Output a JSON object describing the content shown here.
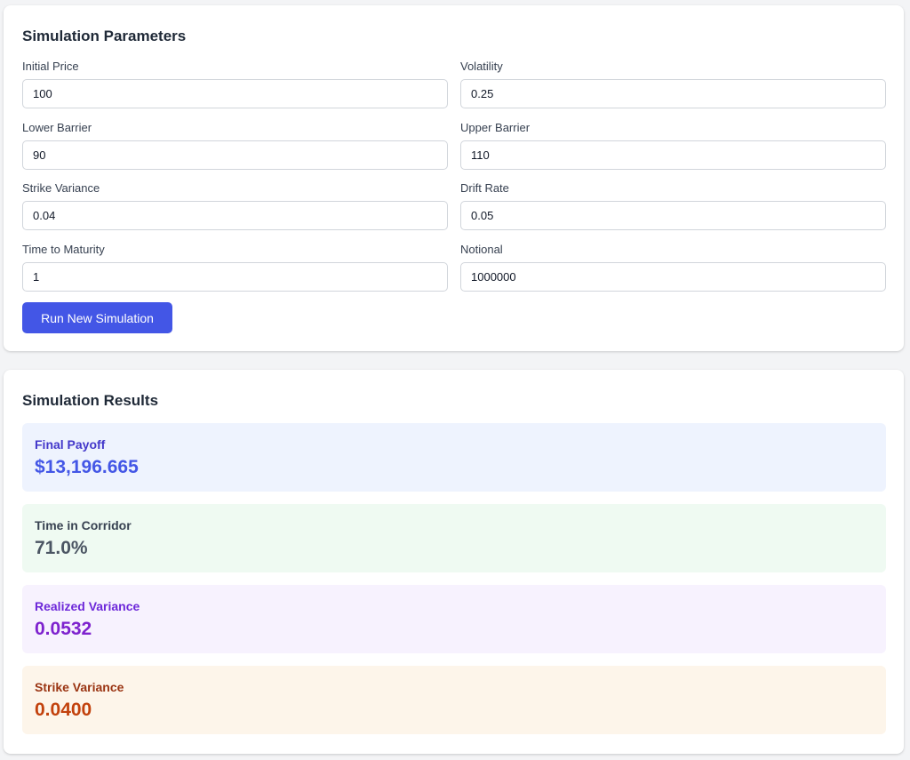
{
  "parameters": {
    "title": "Simulation Parameters",
    "fields": {
      "initial_price": {
        "label": "Initial Price",
        "value": "100"
      },
      "volatility": {
        "label": "Volatility",
        "value": "0.25"
      },
      "lower_barrier": {
        "label": "Lower Barrier",
        "value": "90"
      },
      "upper_barrier": {
        "label": "Upper Barrier",
        "value": "110"
      },
      "strike_variance": {
        "label": "Strike Variance",
        "value": "0.04"
      },
      "drift_rate": {
        "label": "Drift Rate",
        "value": "0.05"
      },
      "time_to_maturity": {
        "label": "Time to Maturity",
        "value": "1"
      },
      "notional": {
        "label": "Notional",
        "value": "1000000"
      }
    },
    "run_button_label": "Run New Simulation",
    "accent_color": "#4356e6"
  },
  "results": {
    "title": "Simulation Results",
    "final_payoff": {
      "label": "Final Payoff",
      "value": "$13,196.665",
      "color": "#4356e6",
      "background": "#eef3fe"
    },
    "time_in_corridor": {
      "label": "Time in Corridor",
      "value": "71.0%",
      "color": "#4b5563",
      "background": "#effaf2"
    },
    "realized_variance": {
      "label": "Realized Variance",
      "value": "0.0532",
      "color": "#7e22ce",
      "background": "#f7f2fe"
    },
    "strike_variance": {
      "label": "Strike Variance",
      "value": "0.0400",
      "color": "#c2410c",
      "background": "#fdf5ea"
    }
  }
}
